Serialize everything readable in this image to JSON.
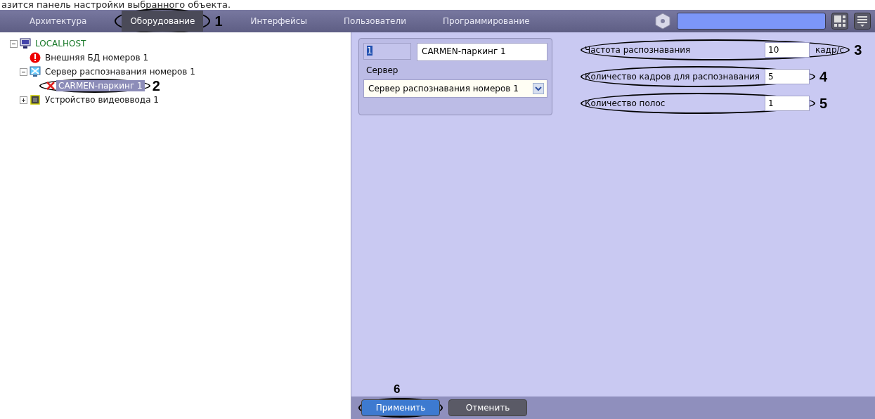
{
  "caption": "азится панель настройки выбранного объекта.",
  "tabs": [
    {
      "label": "Архитектура",
      "selected": false
    },
    {
      "label": "Оборудование",
      "selected": true,
      "callout": "1"
    },
    {
      "label": "Интерфейсы",
      "selected": false
    },
    {
      "label": "Пользователи",
      "selected": false
    },
    {
      "label": "Программирование",
      "selected": false
    }
  ],
  "tree": [
    {
      "label": "LOCALHOST",
      "kind": "computer",
      "expanded": true,
      "selected": false,
      "children": [
        {
          "label": "Внешняя БД номеров 1",
          "kind": "error",
          "selected": false
        },
        {
          "label": "Сервер распознавания номеров 1",
          "kind": "server",
          "expanded": true,
          "selected": false,
          "children": [
            {
              "label": "CARMEN-паркинг 1",
              "kind": "cross",
              "selected": true,
              "callout": "2"
            }
          ]
        },
        {
          "label": "Устройство видеоввода 1",
          "kind": "chip",
          "expanded": false,
          "selected": false
        }
      ]
    }
  ],
  "object_card": {
    "number": "1",
    "name": "CARMEN-паркинг 1",
    "server_label": "Сервер",
    "server_value": "Сервер распознавания номеров 1"
  },
  "settings": [
    {
      "label": "Частота распознавания",
      "value": "10",
      "unit": "кадр/с",
      "callout": "3"
    },
    {
      "label": "Количество кадров для распознавания",
      "value": "5",
      "callout": "4"
    },
    {
      "label": "Количество полос",
      "value": "1",
      "callout": "5"
    }
  ],
  "buttons": [
    {
      "label": "Применить",
      "kind": "primary",
      "callout": "6"
    },
    {
      "label": "Отменить",
      "kind": "secondary"
    }
  ]
}
